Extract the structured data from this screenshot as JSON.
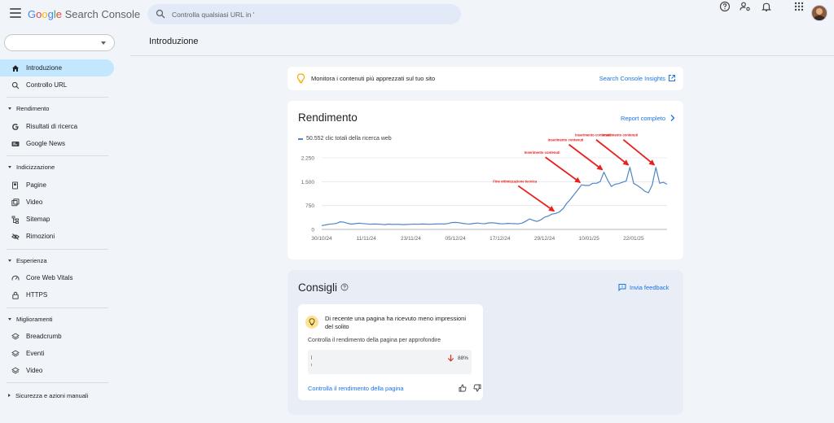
{
  "header": {
    "logo_google": [
      "G",
      "o",
      "o",
      "g",
      "l",
      "e"
    ],
    "logo_product": "Search Console",
    "search_placeholder": "Controlla qualsiasi URL in '"
  },
  "sidebar": {
    "top_items": [
      {
        "label": "Introduzione",
        "icon": "home-icon",
        "active": true
      },
      {
        "label": "Controllo URL",
        "icon": "search-icon"
      }
    ],
    "sections": [
      {
        "label": "Rendimento",
        "items": [
          {
            "label": "Risultati di ricerca",
            "icon": "google-g-icon"
          },
          {
            "label": "Google News",
            "icon": "news-icon"
          }
        ]
      },
      {
        "label": "Indicizzazione",
        "items": [
          {
            "label": "Pagine",
            "icon": "pages-icon"
          },
          {
            "label": "Video",
            "icon": "video-icon"
          },
          {
            "label": "Sitemap",
            "icon": "sitemap-icon"
          },
          {
            "label": "Rimozioni",
            "icon": "removals-icon"
          }
        ]
      },
      {
        "label": "Esperienza",
        "items": [
          {
            "label": "Core Web Vitals",
            "icon": "gauge-icon"
          },
          {
            "label": "HTTPS",
            "icon": "lock-icon"
          }
        ]
      },
      {
        "label": "Miglioramenti",
        "items": [
          {
            "label": "Breadcrumb",
            "icon": "layers-icon"
          },
          {
            "label": "Eventi",
            "icon": "layers-icon"
          },
          {
            "label": "Video",
            "icon": "layers-icon"
          }
        ]
      },
      {
        "label": "Sicurezza e azioni manuali",
        "collapsed": true,
        "items": []
      }
    ]
  },
  "main": {
    "page_title": "Introduzione",
    "insights": {
      "text": "Monitora i contenuti più apprezzati sul tuo sito",
      "link": "Search Console Insights"
    },
    "performance": {
      "title": "Rendimento",
      "report_link": "Report completo",
      "legend": "50.552 clic totali della ricerca web"
    },
    "consigli": {
      "title": "Consigli",
      "feedback": "Invia feedback",
      "tip": {
        "headline": "Di recente una pagina ha ricevuto meno impressioni del solito",
        "sub": "Controlla il rendimento della pagina per approfondire",
        "change": "88%",
        "link": "Controlla il rendimento della pagina"
      }
    }
  },
  "chart_data": {
    "type": "line",
    "series": [
      {
        "name": "",
        "color": "#4f86c6",
        "values": [
          120,
          140,
          160,
          175,
          190,
          240,
          225,
          190,
          165,
          180,
          195,
          185,
          175,
          160,
          170,
          165,
          160,
          150,
          165,
          155,
          160,
          155,
          150,
          155,
          160,
          165,
          160,
          170,
          165,
          160,
          165,
          170,
          175,
          170,
          185,
          215,
          220,
          210,
          190,
          175,
          170,
          190,
          200,
          185,
          180,
          205,
          210,
          195,
          180,
          175,
          190,
          185,
          180,
          175,
          200,
          260,
          330,
          280,
          250,
          300,
          380,
          420,
          480,
          500,
          550,
          650,
          820,
          950,
          1100,
          1250,
          1400,
          1380,
          1380,
          1450,
          1450,
          1500,
          1800,
          1550,
          1350,
          1420,
          1440,
          1480,
          1520,
          1950,
          1450,
          1380,
          1300,
          1200,
          1150,
          1400,
          1950,
          1450,
          1480,
          1420
        ]
      }
    ],
    "x_tick_labels": [
      "30/10/24",
      "11/11/24",
      "23/11/24",
      "05/12/24",
      "17/12/24",
      "29/12/24",
      "10/01/25",
      "22/01/25"
    ],
    "x_tick_positions": [
      0,
      12,
      24,
      36,
      48,
      60,
      72,
      84
    ],
    "y_ticks": [
      0,
      750,
      1500,
      2250
    ],
    "y_tick_labels": [
      "0",
      "750",
      "1.500",
      "2.250"
    ],
    "ylim": [
      0,
      2250
    ],
    "grid": true,
    "annotations": [
      {
        "text": "Fine ottimizzazione tecnica",
        "index": 63
      },
      {
        "text": "Inserimento contenuti",
        "index": 70
      },
      {
        "text": "Inserimento contenuti",
        "index": 76
      },
      {
        "text": "Inserimento contenuti",
        "index": 83
      },
      {
        "text": "Inserimento contenuti",
        "index": 90
      }
    ],
    "annotation_color": "#e8201e"
  },
  "colors": {
    "accent": "#1a73e8",
    "active_nav": "#c2e7ff",
    "background": "#f1f4f9"
  }
}
